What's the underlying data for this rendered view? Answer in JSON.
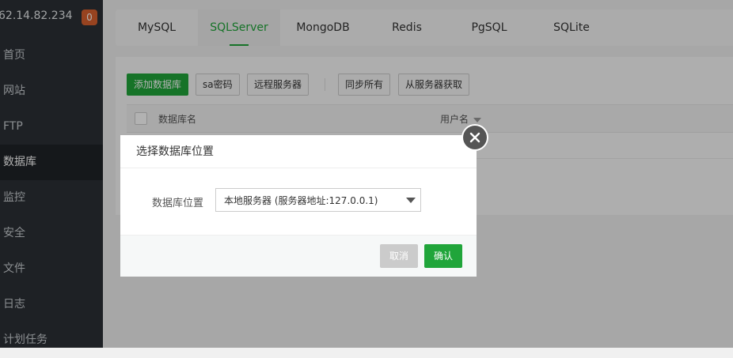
{
  "sidebar": {
    "ip": "62.14.82.234",
    "badge": "0",
    "items": [
      {
        "label": "首页"
      },
      {
        "label": "网站"
      },
      {
        "label": "FTP"
      },
      {
        "label": "数据库"
      },
      {
        "label": "监控"
      },
      {
        "label": "安全"
      },
      {
        "label": "文件"
      },
      {
        "label": "日志"
      },
      {
        "label": "计划任务"
      }
    ],
    "active_item": "数据库"
  },
  "tabs": [
    {
      "label": "MySQL"
    },
    {
      "label": "SQLServer"
    },
    {
      "label": "MongoDB"
    },
    {
      "label": "Redis"
    },
    {
      "label": "PgSQL"
    },
    {
      "label": "SQLite"
    }
  ],
  "active_tab": "SQLServer",
  "toolbar": {
    "add_db": "添加数据库",
    "sa_password": "sa密码",
    "remote_server": "远程服务器",
    "sync_all": "同步所有",
    "fetch_from_server": "从服务器获取"
  },
  "table": {
    "columns": [
      "数据库名",
      "用户名"
    ]
  },
  "dialog": {
    "title": "选择数据库位置",
    "field_label": "数据库位置",
    "select_value": "本地服务器 (服务器地址:127.0.0.1)",
    "cancel": "取消",
    "confirm": "确认"
  },
  "colors": {
    "accent": "#20a53a",
    "sidebar_bg": "#2b3036",
    "badge": "#d9612e"
  },
  "icons": {
    "close": "close-icon",
    "sort": "sort-down-icon",
    "dropdown": "chevron-down-icon"
  }
}
